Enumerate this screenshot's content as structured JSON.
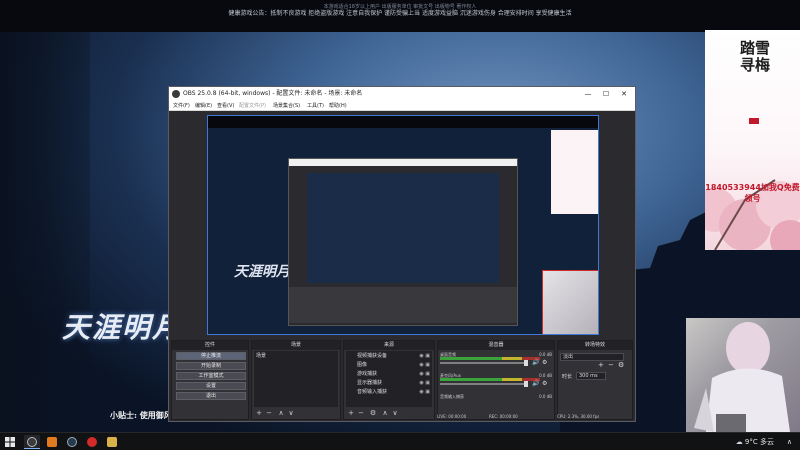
{
  "game": {
    "notice_line": "健康游戏公告：抵制不良游戏 拒绝盗版游戏 注意自我保护 谨防受骗上当 适度游戏益脑 沉迷游戏伤身 合理安排时间 享受健康生活",
    "notice_small": "本游戏适合18岁以上用户 出版服务单位 审批文号 出版物号 著作权人",
    "logo_text": "天涯明月",
    "tip_text": "小贴士: 使用御风冲"
  },
  "promo": {
    "title": "踏雪寻梅",
    "qq_text": "1840533944加我Q免费领号"
  },
  "obs": {
    "title": "OBS 25.0.8 (64-bit, windows) - 配置文件: 未命名 - 场景: 未命名",
    "menu": [
      "文件(F)",
      "编辑(E)",
      "查看(V)",
      "配置文件(P)",
      "场景集合(S)",
      "工具(T)",
      "帮助(H)"
    ],
    "docks": {
      "controls": {
        "title": "控件",
        "buttons": [
          "停止推流",
          "开始录制",
          "工作室模式",
          "设置",
          "退出"
        ]
      },
      "scenes": {
        "title": "场景",
        "items": [
          "场景"
        ]
      },
      "sources": {
        "title": "来源",
        "items": [
          "视频捕获设备",
          "图像",
          "游戏捕获",
          "显示器捕获",
          "音频输入捕获"
        ]
      },
      "mixer": {
        "title": "混音器",
        "channels": [
          {
            "name": "桌面音频",
            "db": "0.0 dB"
          },
          {
            "name": "麦克风/Aux",
            "db": "0.0 dB"
          },
          {
            "name": "音频输入捕获",
            "db": "0.0 dB"
          }
        ]
      },
      "transitions": {
        "title": "转场特效",
        "selected": "淡出",
        "duration_label": "时长",
        "duration_value": "300 ms"
      }
    },
    "status": {
      "live": "LIVE: 00:00:00",
      "rec": "REC: 00:00:00",
      "cpu": "CPU: 2.3%, 30.00 fps"
    },
    "win_controls": {
      "minimize": "—",
      "maximize": "☐",
      "close": "✕"
    }
  },
  "taskbar": {
    "weather": "9°C 多云",
    "apps": [
      "obs",
      "fox",
      "steam",
      "netease-music",
      "game"
    ]
  },
  "colors": {
    "obs_bg": "#2b2b2f",
    "preview_border": "#3c78d8",
    "cam_border": "#d02a2a",
    "promo_red": "#c2182b"
  }
}
